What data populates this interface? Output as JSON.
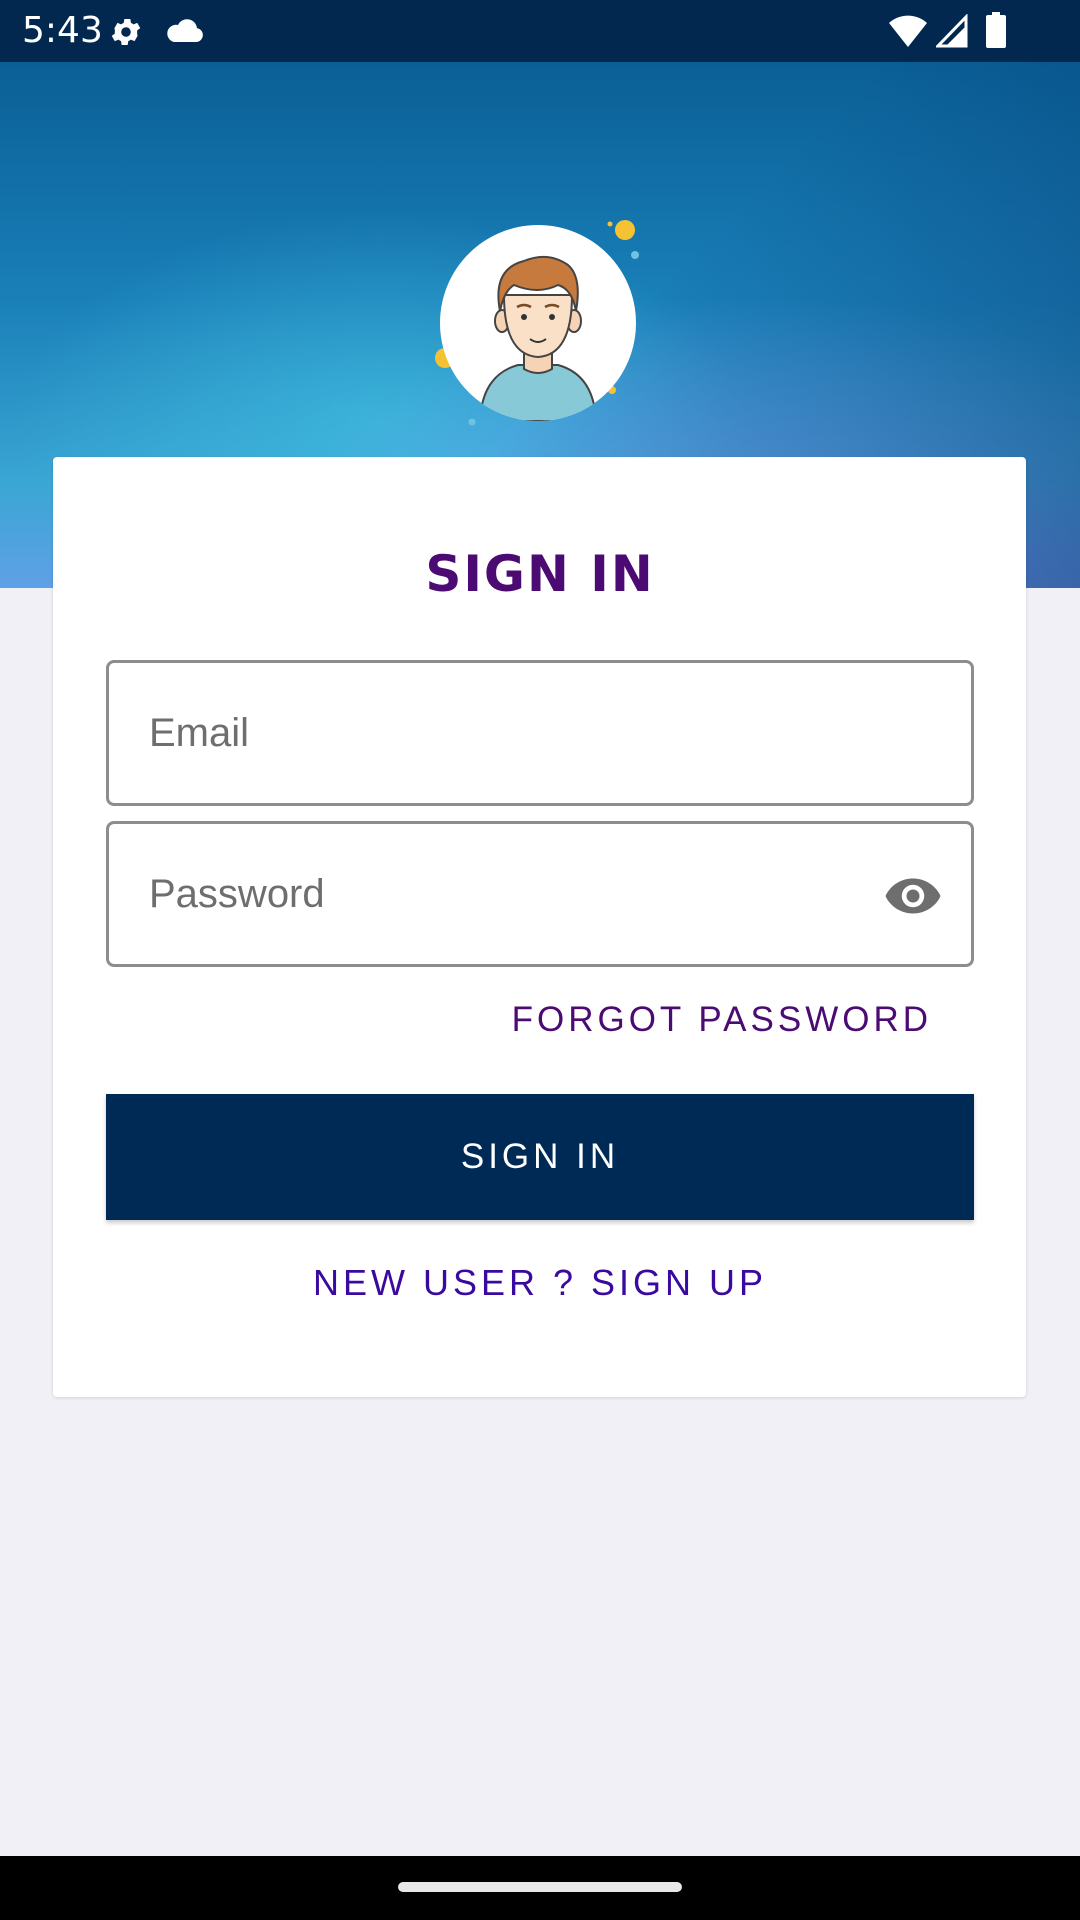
{
  "status_bar": {
    "time": "5:43",
    "icons": [
      "gear-icon",
      "cloud-icon",
      "wifi-icon",
      "signal-icon",
      "battery-icon"
    ]
  },
  "header": {
    "avatar_icon": "user-avatar-icon"
  },
  "card": {
    "title": "SIGN IN",
    "email": {
      "placeholder": "Email",
      "value": ""
    },
    "password": {
      "placeholder": "Password",
      "value": "",
      "toggle_icon": "eye-icon"
    },
    "forgot_password": "FORGOT PASSWORD",
    "sign_in_button": "SIGN IN",
    "sign_up_link": "NEW USER ? SIGN UP"
  },
  "colors": {
    "status_bar": "#02284f",
    "title": "#4b0b73",
    "button": "#002a56",
    "signup": "#3a0aa0",
    "page_background": "#f1f0f6"
  }
}
